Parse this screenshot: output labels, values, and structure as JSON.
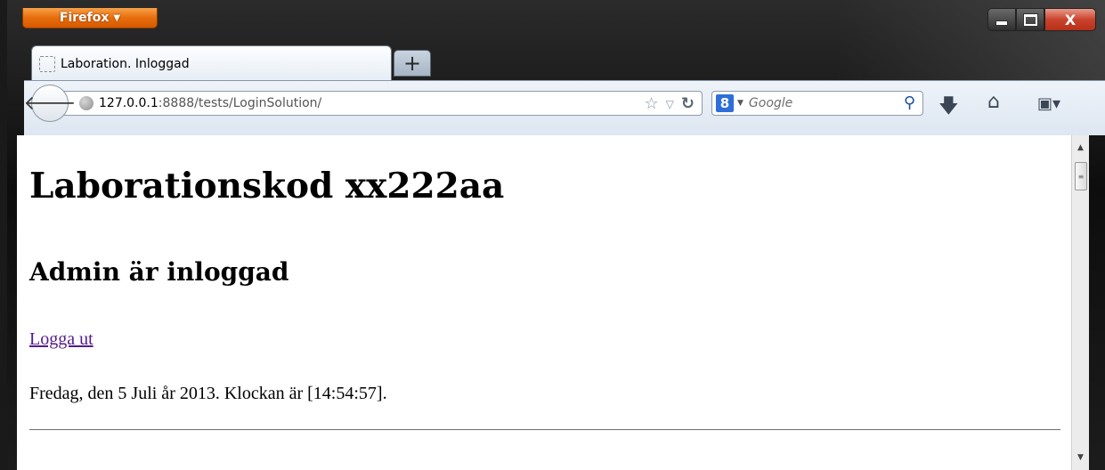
{
  "browser": {
    "app_button": "Firefox",
    "tab_title": "Laboration. Inloggad",
    "new_tab_symbol": "+",
    "url_host": "127.0.0.1",
    "url_rest": ":8888/tests/LoginSolution/",
    "search_engine_icon": "8",
    "search_placeholder": "Google",
    "window_close_symbol": "X"
  },
  "page": {
    "heading": "Laborationskod xx222aa",
    "subheading": "Admin är inloggad",
    "logout_link": "Logga ut",
    "date_text": "Fredag, den 5 Juli år 2013. Klockan är [14:54:57]."
  },
  "icons": [
    "back-arrow-icon",
    "globe-icon",
    "bookmark-star-icon",
    "history-dropdown-icon",
    "reload-icon",
    "search-magnifier-icon",
    "downloads-icon",
    "home-icon",
    "bookmarks-menu-icon"
  ]
}
